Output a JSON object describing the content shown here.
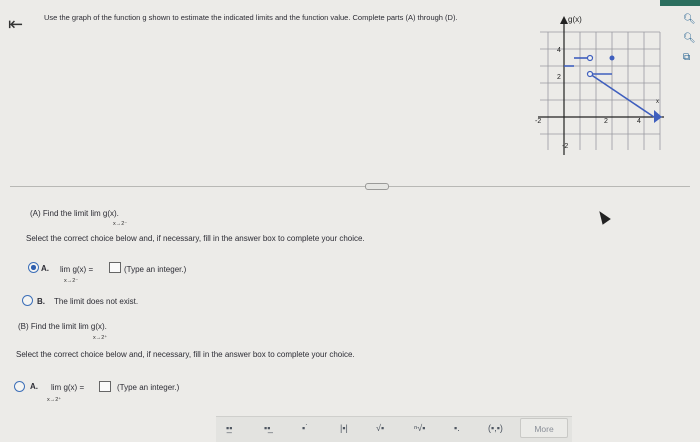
{
  "header": {
    "back_icon": "back-arrow-icon",
    "instructions": "Use the graph of the function g shown to estimate the indicated limits and the function value. Complete parts (A) through (D)."
  },
  "graph": {
    "title": "g(x)",
    "x_label": "x",
    "tick_x_neg": "-2",
    "tick_x_2": "2",
    "tick_x_4": "4",
    "tick_y_2": "2",
    "tick_y_4": "4",
    "tick_y_neg": "-2"
  },
  "part_a": {
    "prompt": "(A) Find the limit  lim g(x).",
    "prompt_sub": "x→2⁻",
    "select_instruction": "Select the correct choice below and, if necessary, fill in the answer box to complete your choice.",
    "choice_a_letter": "A.",
    "choice_a_expr": "lim g(x) =",
    "choice_a_sub": "x→2⁻",
    "choice_a_hint": "(Type an integer.)",
    "choice_b_letter": "B.",
    "choice_b_text": "The limit does not exist.",
    "selected": "A"
  },
  "part_b": {
    "prompt": "(B) Find the limit  lim g(x).",
    "prompt_sub": "x→2⁺",
    "select_instruction": "Select the correct choice below and, if necessary, fill in the answer box to complete your choice.",
    "choice_a_letter": "A.",
    "choice_a_expr": "lim g(x) =",
    "choice_a_sub": "x→2⁺",
    "choice_a_hint": "(Type an integer.)"
  },
  "toolbar": {
    "more_label": "More",
    "tools": [
      "fraction",
      "mixed-number",
      "exponent",
      "absolute-value",
      "sqrt",
      "nth-root",
      "subscript",
      "ordered-pair"
    ],
    "ordered_pair_label": "(▪,▪)"
  },
  "colors": {
    "accent": "#2f5fae",
    "graph_line": "#3f5fbe"
  }
}
